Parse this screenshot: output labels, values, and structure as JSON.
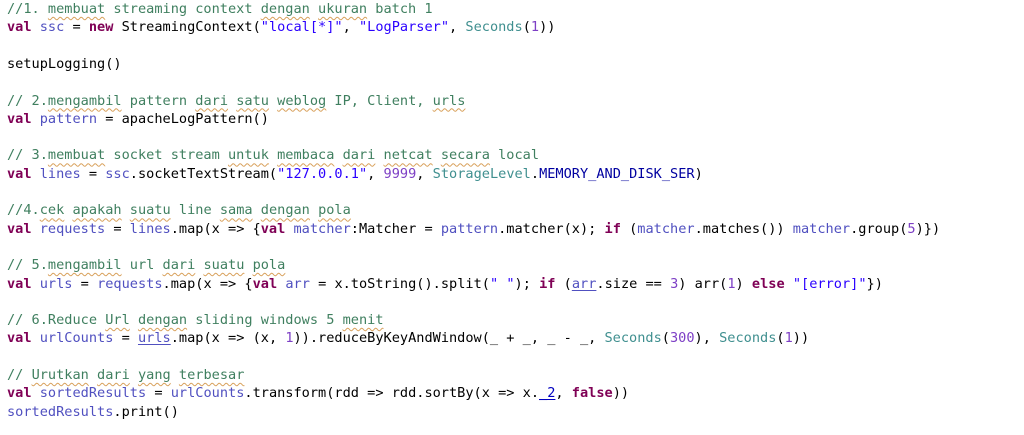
{
  "lines": [
    {
      "row": 0,
      "tokens": [
        {
          "t": "//1. ",
          "c": "c"
        },
        {
          "t": "membuat",
          "c": "c sq"
        },
        {
          "t": " streaming context ",
          "c": "c"
        },
        {
          "t": "dengan",
          "c": "c sq"
        },
        {
          "t": " ",
          "c": "c"
        },
        {
          "t": "ukuran",
          "c": "c sq"
        },
        {
          "t": " batch 1",
          "c": "c"
        }
      ]
    },
    {
      "row": 1,
      "tokens": [
        {
          "t": "val ",
          "c": "kw"
        },
        {
          "t": "ssc",
          "c": "lv"
        },
        {
          "t": " = ",
          "c": "vr"
        },
        {
          "t": "new ",
          "c": "kw"
        },
        {
          "t": "StreamingContext(",
          "c": "vr"
        },
        {
          "t": "\"local[*]\"",
          "c": "st"
        },
        {
          "t": ", ",
          "c": "vr"
        },
        {
          "t": "\"LogParser\"",
          "c": "st"
        },
        {
          "t": ", ",
          "c": "vr"
        },
        {
          "t": "Seconds",
          "c": "ty"
        },
        {
          "t": "(",
          "c": "vr"
        },
        {
          "t": "1",
          "c": "nm"
        },
        {
          "t": "))",
          "c": "vr"
        }
      ]
    },
    {
      "row": 3,
      "tokens": [
        {
          "t": "setupLogging()",
          "c": "vr"
        }
      ]
    },
    {
      "row": 5,
      "tokens": [
        {
          "t": "// 2.",
          "c": "c"
        },
        {
          "t": "mengambil",
          "c": "c sq"
        },
        {
          "t": " pattern ",
          "c": "c"
        },
        {
          "t": "dari",
          "c": "c sq"
        },
        {
          "t": " ",
          "c": "c"
        },
        {
          "t": "satu",
          "c": "c sq"
        },
        {
          "t": " ",
          "c": "c"
        },
        {
          "t": "weblog",
          "c": "c sq"
        },
        {
          "t": " IP, Client, ",
          "c": "c"
        },
        {
          "t": "urls",
          "c": "c sq"
        }
      ]
    },
    {
      "row": 6,
      "tokens": [
        {
          "t": "val ",
          "c": "kw"
        },
        {
          "t": "pattern",
          "c": "lv"
        },
        {
          "t": " = apacheLogPattern()",
          "c": "vr"
        }
      ]
    },
    {
      "row": 8,
      "tokens": [
        {
          "t": "// 3.",
          "c": "c"
        },
        {
          "t": "membuat",
          "c": "c sq"
        },
        {
          "t": " socket stream ",
          "c": "c"
        },
        {
          "t": "untuk",
          "c": "c sq"
        },
        {
          "t": " ",
          "c": "c"
        },
        {
          "t": "membaca",
          "c": "c sq"
        },
        {
          "t": " ",
          "c": "c"
        },
        {
          "t": "dari",
          "c": "c sq"
        },
        {
          "t": " ",
          "c": "c"
        },
        {
          "t": "netcat",
          "c": "c sq"
        },
        {
          "t": " ",
          "c": "c"
        },
        {
          "t": "secara",
          "c": "c sq"
        },
        {
          "t": " local",
          "c": "c"
        }
      ]
    },
    {
      "row": 9,
      "tokens": [
        {
          "t": "val ",
          "c": "kw"
        },
        {
          "t": "lines",
          "c": "lv"
        },
        {
          "t": " = ",
          "c": "vr"
        },
        {
          "t": "ssc",
          "c": "lv"
        },
        {
          "t": ".socketTextStream(",
          "c": "vr"
        },
        {
          "t": "\"127.0.0.1\"",
          "c": "st"
        },
        {
          "t": ", ",
          "c": "vr"
        },
        {
          "t": "9999",
          "c": "nm"
        },
        {
          "t": ", ",
          "c": "vr"
        },
        {
          "t": "StorageLevel",
          "c": "ty"
        },
        {
          "t": ".",
          "c": "vr"
        },
        {
          "t": "MEMORY_AND_DISK_SER",
          "c": "cn"
        },
        {
          "t": ")",
          "c": "vr"
        }
      ]
    },
    {
      "row": 11,
      "tokens": [
        {
          "t": "//4.",
          "c": "c"
        },
        {
          "t": "cek",
          "c": "c sq"
        },
        {
          "t": " ",
          "c": "c"
        },
        {
          "t": "apakah",
          "c": "c sq"
        },
        {
          "t": " ",
          "c": "c"
        },
        {
          "t": "suatu",
          "c": "c sq"
        },
        {
          "t": " line ",
          "c": "c"
        },
        {
          "t": "sama",
          "c": "c sq"
        },
        {
          "t": " ",
          "c": "c"
        },
        {
          "t": "dengan",
          "c": "c sq"
        },
        {
          "t": " ",
          "c": "c"
        },
        {
          "t": "pola",
          "c": "c sq"
        }
      ]
    },
    {
      "row": 12,
      "tokens": [
        {
          "t": "val ",
          "c": "kw"
        },
        {
          "t": "requests",
          "c": "lv"
        },
        {
          "t": " = ",
          "c": "vr"
        },
        {
          "t": "lines",
          "c": "lv"
        },
        {
          "t": ".map(x => {",
          "c": "vr"
        },
        {
          "t": "val ",
          "c": "kw"
        },
        {
          "t": "matcher",
          "c": "lv"
        },
        {
          "t": ":Matcher = ",
          "c": "vr"
        },
        {
          "t": "pattern",
          "c": "lv"
        },
        {
          "t": ".matcher(x); ",
          "c": "vr"
        },
        {
          "t": "if ",
          "c": "kw"
        },
        {
          "t": "(",
          "c": "vr"
        },
        {
          "t": "matcher",
          "c": "lv"
        },
        {
          "t": ".matches()) ",
          "c": "vr"
        },
        {
          "t": "matcher",
          "c": "lv"
        },
        {
          "t": ".group(",
          "c": "vr"
        },
        {
          "t": "5",
          "c": "nm"
        },
        {
          "t": ")})",
          "c": "vr"
        }
      ]
    },
    {
      "row": 14,
      "tokens": [
        {
          "t": "// 5.",
          "c": "c"
        },
        {
          "t": "mengambil",
          "c": "c sq"
        },
        {
          "t": " url ",
          "c": "c"
        },
        {
          "t": "dari",
          "c": "c sq"
        },
        {
          "t": " ",
          "c": "c"
        },
        {
          "t": "suatu",
          "c": "c sq"
        },
        {
          "t": " ",
          "c": "c"
        },
        {
          "t": "pola",
          "c": "c sq"
        }
      ]
    },
    {
      "row": 15,
      "tokens": [
        {
          "t": "val ",
          "c": "kw"
        },
        {
          "t": "urls",
          "c": "lv"
        },
        {
          "t": " = ",
          "c": "vr"
        },
        {
          "t": "requests",
          "c": "lv"
        },
        {
          "t": ".map(x => {",
          "c": "vr"
        },
        {
          "t": "val ",
          "c": "kw"
        },
        {
          "t": "arr",
          "c": "lv"
        },
        {
          "t": " = x.toString().split(",
          "c": "vr"
        },
        {
          "t": "\" \"",
          "c": "st"
        },
        {
          "t": "); ",
          "c": "vr"
        },
        {
          "t": "if ",
          "c": "kw"
        },
        {
          "t": "(",
          "c": "vr"
        },
        {
          "t": "arr",
          "c": "lv ul"
        },
        {
          "t": ".size == ",
          "c": "vr"
        },
        {
          "t": "3",
          "c": "nm"
        },
        {
          "t": ") arr(",
          "c": "vr"
        },
        {
          "t": "1",
          "c": "nm"
        },
        {
          "t": ") ",
          "c": "vr"
        },
        {
          "t": "else ",
          "c": "kw"
        },
        {
          "t": "\"[error]\"",
          "c": "st"
        },
        {
          "t": "})",
          "c": "vr"
        }
      ]
    },
    {
      "row": 17,
      "tokens": [
        {
          "t": "// 6.Reduce ",
          "c": "c"
        },
        {
          "t": "Url",
          "c": "c sq"
        },
        {
          "t": " ",
          "c": "c"
        },
        {
          "t": "dengan",
          "c": "c sq"
        },
        {
          "t": " sliding windows 5 ",
          "c": "c"
        },
        {
          "t": "menit",
          "c": "c sq"
        }
      ]
    },
    {
      "row": 18,
      "tokens": [
        {
          "t": "val ",
          "c": "kw"
        },
        {
          "t": "urlCounts",
          "c": "lv"
        },
        {
          "t": " = ",
          "c": "vr"
        },
        {
          "t": "urls",
          "c": "lv ul"
        },
        {
          "t": ".map(x => (x, ",
          "c": "vr"
        },
        {
          "t": "1",
          "c": "nm"
        },
        {
          "t": ")).reduceByKeyAndWindow(_ + _, _ - _, ",
          "c": "vr"
        },
        {
          "t": "Seconds",
          "c": "ty"
        },
        {
          "t": "(",
          "c": "vr"
        },
        {
          "t": "300",
          "c": "nm"
        },
        {
          "t": "), ",
          "c": "vr"
        },
        {
          "t": "Seconds",
          "c": "ty"
        },
        {
          "t": "(",
          "c": "vr"
        },
        {
          "t": "1",
          "c": "nm"
        },
        {
          "t": "))",
          "c": "vr"
        }
      ]
    },
    {
      "row": 20,
      "tokens": [
        {
          "t": "// ",
          "c": "c"
        },
        {
          "t": "Urutkan",
          "c": "c sq"
        },
        {
          "t": " ",
          "c": "c"
        },
        {
          "t": "dari",
          "c": "c sq"
        },
        {
          "t": " ",
          "c": "c"
        },
        {
          "t": "yang",
          "c": "c sq"
        },
        {
          "t": " ",
          "c": "c"
        },
        {
          "t": "terbesar",
          "c": "c sq"
        }
      ]
    },
    {
      "row": 21,
      "tokens": [
        {
          "t": "val ",
          "c": "kw"
        },
        {
          "t": "sortedResults",
          "c": "lv"
        },
        {
          "t": " = ",
          "c": "vr"
        },
        {
          "t": "urlCounts",
          "c": "lv"
        },
        {
          "t": ".transform(rdd => rdd.sortBy(x => x.",
          "c": "vr"
        },
        {
          "t": "_2",
          "c": "fl ul"
        },
        {
          "t": ", ",
          "c": "vr"
        },
        {
          "t": "false",
          "c": "kw"
        },
        {
          "t": "))",
          "c": "vr"
        }
      ]
    },
    {
      "row": 22,
      "tokens": [
        {
          "t": "sortedResults",
          "c": "lv"
        },
        {
          "t": ".print()",
          "c": "vr"
        }
      ]
    }
  ]
}
